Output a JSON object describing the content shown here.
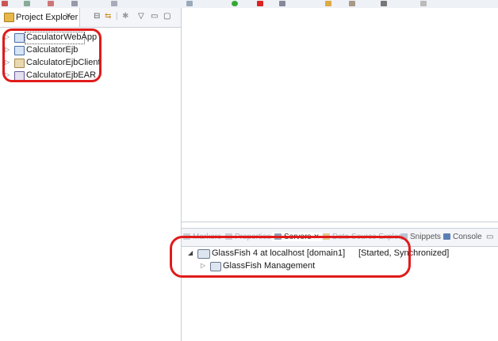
{
  "project_explorer": {
    "tab_title": "Project Explorer",
    "close_glyph": "✕",
    "projects": [
      {
        "label": "CaculatorWebApp",
        "icon": "web-project-icon"
      },
      {
        "label": "CalculatorEjb",
        "icon": "ejb-project-icon"
      },
      {
        "label": "CalculatorEjbClient",
        "icon": "client-project-icon"
      },
      {
        "label": "CalculatorEjbEAR",
        "icon": "ear-project-icon"
      }
    ]
  },
  "bottom_panel": {
    "tabs": [
      {
        "label": "Markers",
        "active": false
      },
      {
        "label": "Properties",
        "active": false
      },
      {
        "label": "Servers",
        "active": true
      },
      {
        "label": "Data Source Explorer",
        "active": false
      },
      {
        "label": "Snippets",
        "active": false
      },
      {
        "label": "Console",
        "active": false
      }
    ],
    "servers": {
      "server_name": "GlassFish 4 at localhost [domain1]",
      "server_status": "[Started, Synchronized]",
      "child": "GlassFish Management"
    }
  },
  "colors": {
    "highlight_oval": "#e01b1b",
    "panel_border": "#c9ced8"
  }
}
